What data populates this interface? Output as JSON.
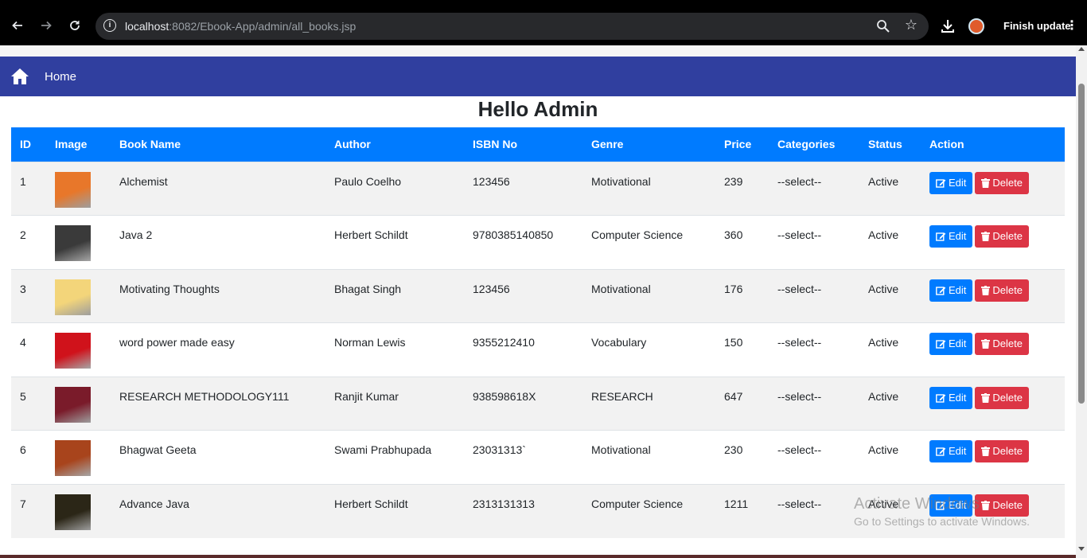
{
  "browser": {
    "url_host": "localhost",
    "url_rest": ":8082/Ebook-App/admin/all_books.jsp",
    "update_label": "Finish update"
  },
  "navbar": {
    "home_label": "Home"
  },
  "page": {
    "title": "Hello Admin"
  },
  "table": {
    "headers": [
      "ID",
      "Image",
      "Book Name",
      "Author",
      "ISBN No",
      "Genre",
      "Price",
      "Categories",
      "Status",
      "Action"
    ],
    "rows": [
      {
        "id": "1",
        "name": "Alchemist",
        "author": "Paulo Coelho",
        "isbn": "123456",
        "genre": "Motivational",
        "price": "239",
        "category": "--select--",
        "status": "Active",
        "thumb_color": "#e8772a"
      },
      {
        "id": "2",
        "name": "Java 2",
        "author": "Herbert Schildt",
        "isbn": "9780385140850",
        "genre": "Computer Science",
        "price": "360",
        "category": "--select--",
        "status": "Active",
        "thumb_color": "#3a3a3a"
      },
      {
        "id": "3",
        "name": "Motivating Thoughts",
        "author": "Bhagat Singh",
        "isbn": "123456",
        "genre": "Motivational",
        "price": "176",
        "category": "--select--",
        "status": "Active",
        "thumb_color": "#f3d57a"
      },
      {
        "id": "4",
        "name": "word power made easy",
        "author": "Norman Lewis",
        "isbn": "9355212410",
        "genre": "Vocabulary",
        "price": "150",
        "category": "--select--",
        "status": "Active",
        "thumb_color": "#d0121b"
      },
      {
        "id": "5",
        "name": "RESEARCH METHODOLOGY111",
        "author": "Ranjit Kumar",
        "isbn": "938598618X",
        "genre": "RESEARCH",
        "price": "647",
        "category": "--select--",
        "status": "Active",
        "thumb_color": "#7a1b2a"
      },
      {
        "id": "6",
        "name": "Bhagwat Geeta",
        "author": "Swami Prabhupada",
        "isbn": "23031313`",
        "genre": "Motivational",
        "price": "230",
        "category": "--select--",
        "status": "Active",
        "thumb_color": "#a8441c"
      },
      {
        "id": "7",
        "name": "Advance Java",
        "author": "Herbert Schildt",
        "isbn": "2313131313",
        "genre": "Computer Science",
        "price": "1211",
        "category": "--select--",
        "status": "Active",
        "thumb_color": "#2b2617"
      }
    ],
    "edit_label": "Edit",
    "delete_label": "Delete"
  },
  "watermark": {
    "line1": "Activate Windows",
    "line2": "Go to Settings to activate Windows."
  },
  "colors": {
    "navbar": "#303f9f",
    "table_header": "#007bff",
    "edit": "#007bff",
    "delete": "#dc3545"
  }
}
